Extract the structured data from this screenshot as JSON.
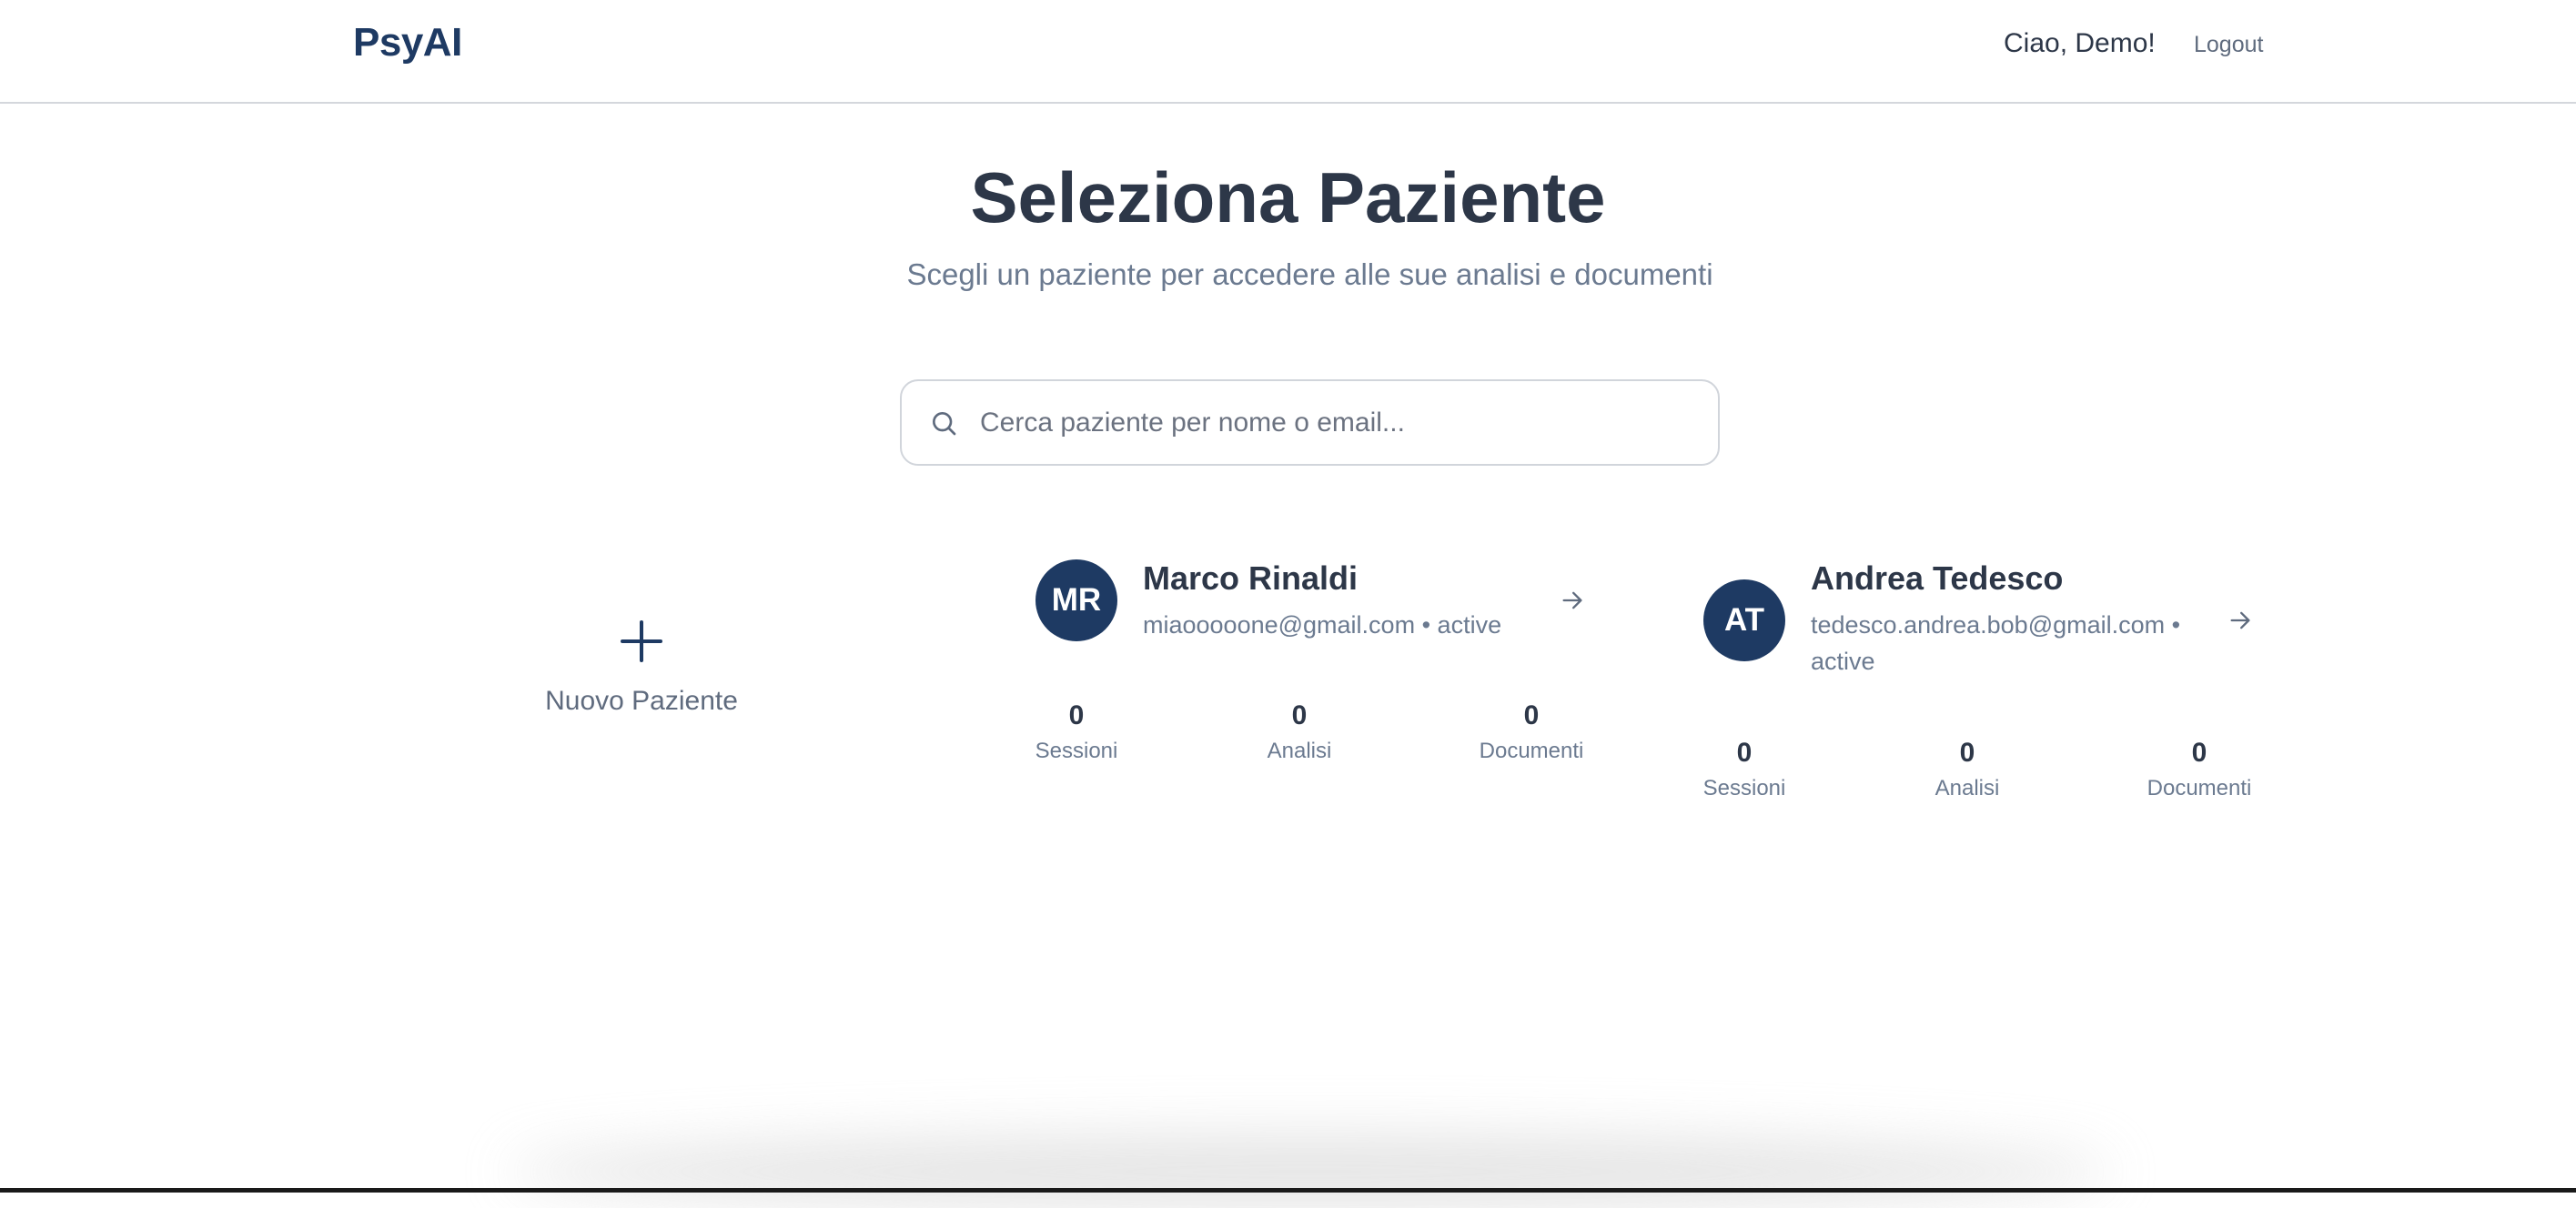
{
  "header": {
    "logo": "PsyAI",
    "greeting": "Ciao, Demo!",
    "logout_label": "Logout"
  },
  "page": {
    "title": "Seleziona Paziente",
    "subtitle": "Scegli un paziente per accedere alle sue analisi e documenti"
  },
  "search": {
    "placeholder": "Cerca paziente per nome o email...",
    "value": "",
    "icon": "search-icon"
  },
  "new_patient": {
    "label": "Nuovo Paziente",
    "icon": "plus-icon"
  },
  "patients": [
    {
      "initials": "MR",
      "name": "Marco Rinaldi",
      "email": "miaooooone@gmail.com",
      "separator": "•",
      "status": "active",
      "stats": [
        {
          "value": "0",
          "label": "Sessioni"
        },
        {
          "value": "0",
          "label": "Analisi"
        },
        {
          "value": "0",
          "label": "Documenti"
        }
      ]
    },
    {
      "initials": "AT",
      "name": "Andrea Tedesco",
      "email": "tedesco.andrea.bob@gmail.com",
      "separator": "•",
      "status": "active",
      "stats": [
        {
          "value": "0",
          "label": "Sessioni"
        },
        {
          "value": "0",
          "label": "Analisi"
        },
        {
          "value": "0",
          "label": "Documenti"
        }
      ]
    }
  ],
  "colors": {
    "brand": "#1e3a63",
    "text": "#2d3748",
    "muted": "#6b7a90",
    "border": "#d1d5db"
  }
}
